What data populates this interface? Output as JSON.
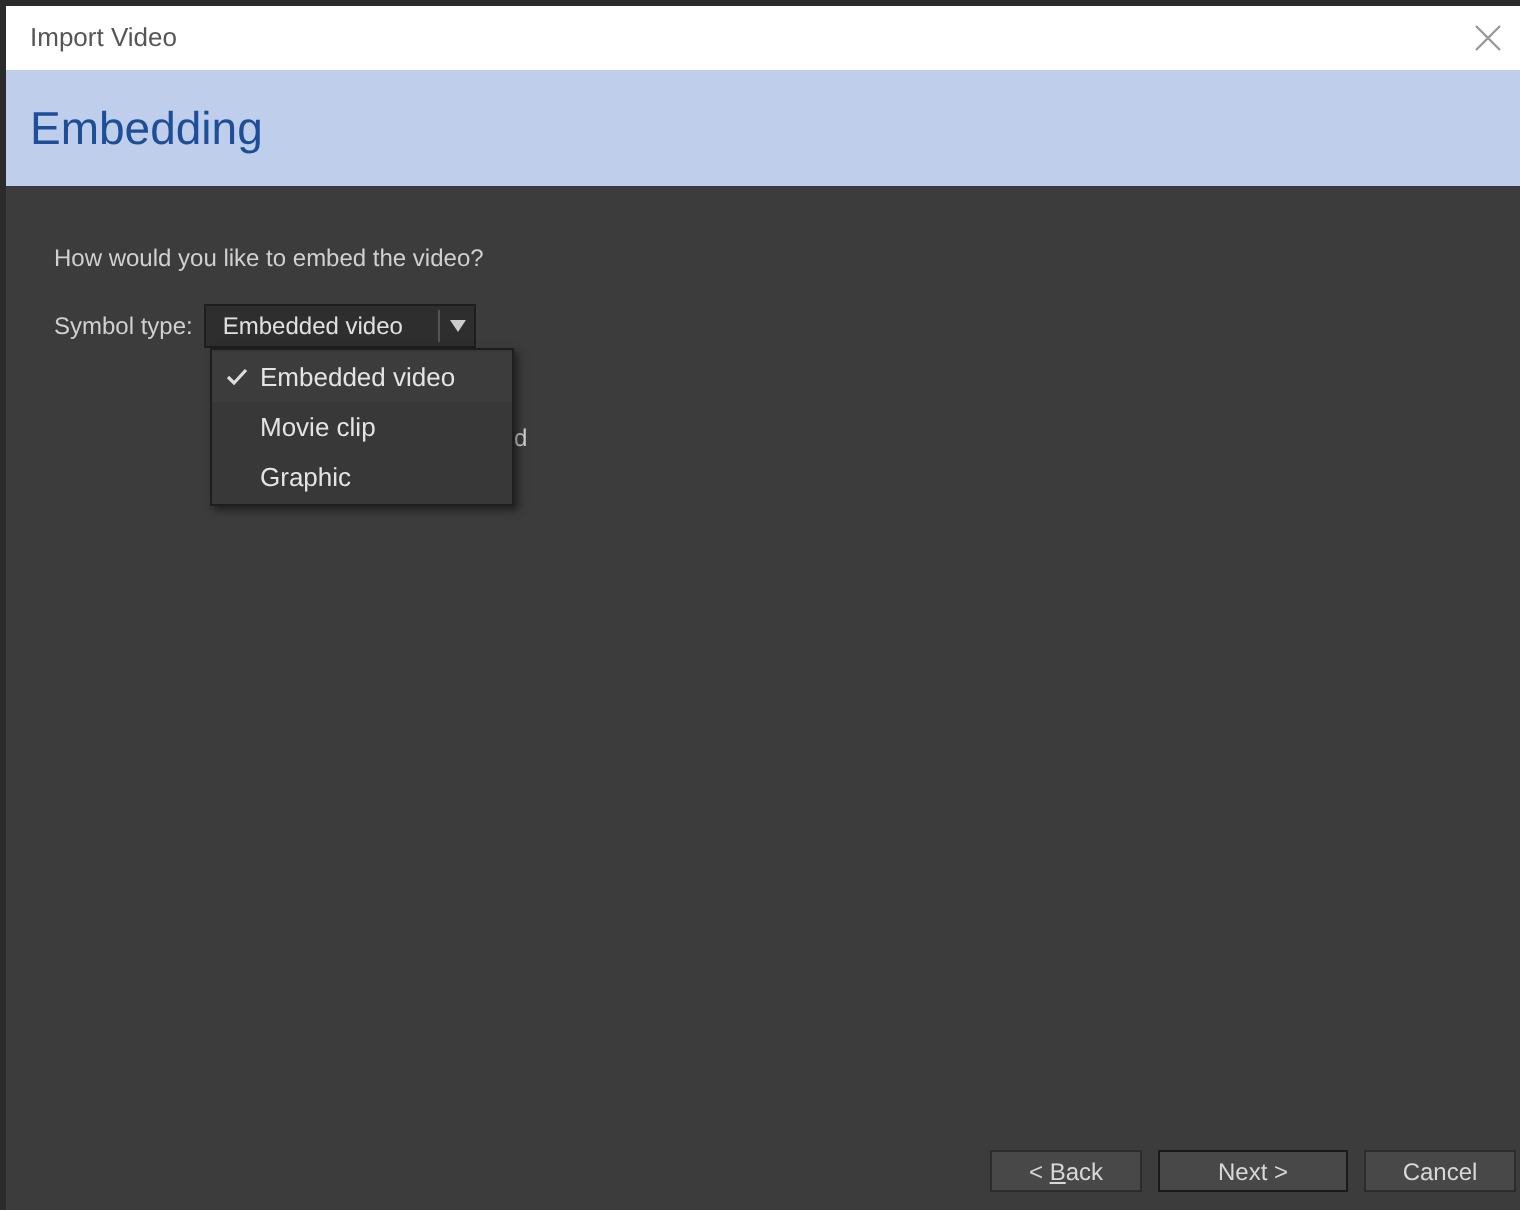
{
  "window": {
    "title": "Import Video"
  },
  "header": {
    "title": "Embedding"
  },
  "question": "How would you like to embed the video?",
  "symbol_type": {
    "label": "Symbol type:",
    "value": "Embedded video",
    "expanded": true,
    "options": [
      {
        "label": "Embedded video",
        "selected": true
      },
      {
        "label": "Movie clip",
        "selected": false
      },
      {
        "label": "Graphic",
        "selected": false
      }
    ]
  },
  "covered_text": "d",
  "buttons": [
    {
      "label": "<",
      "access_key": "B",
      "label_rest": "ack",
      "default": false
    },
    {
      "label": "Next >",
      "default": true
    },
    {
      "label": "Cancel",
      "default": false
    }
  ]
}
